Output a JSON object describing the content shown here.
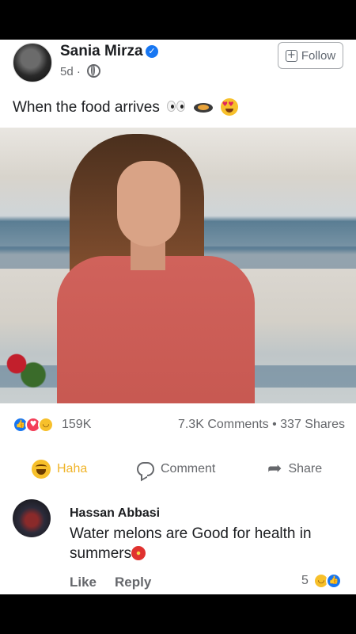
{
  "post": {
    "author": "Sania Mirza",
    "time": "5d",
    "separator": "·",
    "follow_label": "Follow",
    "caption": "When the food arrives"
  },
  "stats": {
    "reactions_count": "159K",
    "comments_shares": "7.3K Comments • 337 Shares"
  },
  "actions": {
    "haha_label": "Haha",
    "comment_label": "Comment",
    "share_label": "Share"
  },
  "comment": {
    "author": "Hassan Abbasi",
    "text": "Water melons are Good for health in summers",
    "like_label": "Like",
    "reply_label": "Reply",
    "reaction_count": "5"
  },
  "icons": {
    "verified": "verified-badge-icon",
    "privacy": "globe-icon",
    "follow": "follow-icon",
    "share": "share-arrow-icon",
    "comment": "comment-bubble-icon"
  },
  "colors": {
    "accent": "#1877f2",
    "haha": "#f0b429",
    "muted": "#65676b"
  }
}
